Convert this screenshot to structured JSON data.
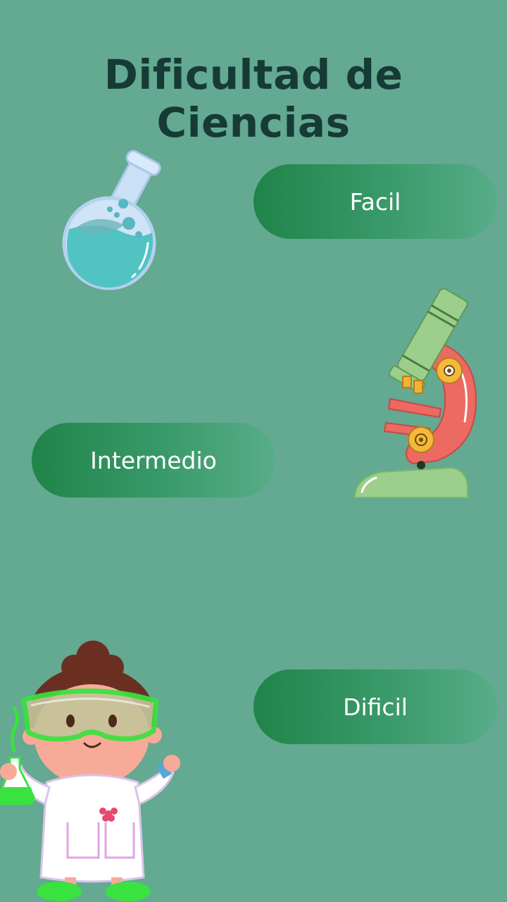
{
  "page": {
    "title": "Dificultad de Ciencias"
  },
  "buttons": {
    "easy": "Facil",
    "medium": "Intermedio",
    "hard": "Dificil"
  },
  "colors": {
    "background": "#64a991",
    "title": "#163b36",
    "button_start": "#1f8449",
    "button_end": "#57ad89",
    "button_text": "#ffffff"
  },
  "illustrations": {
    "flask": "round-flask-icon",
    "microscope": "microscope-icon",
    "scientist": "girl-scientist-illustration"
  }
}
